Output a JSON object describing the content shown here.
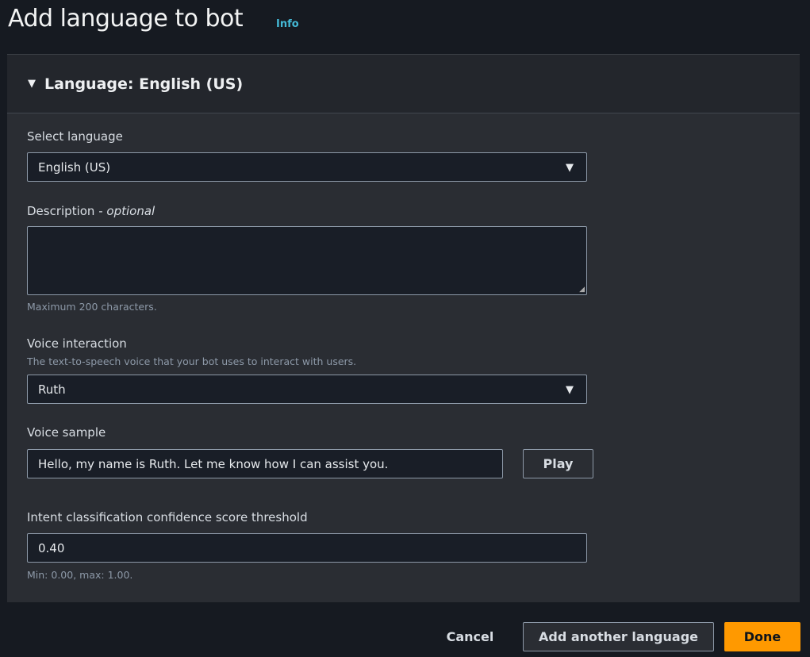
{
  "page": {
    "title": "Add language to bot",
    "info_link": "Info"
  },
  "panel": {
    "header": "Language: English (US)"
  },
  "fields": {
    "language": {
      "label": "Select language",
      "value": "English (US)"
    },
    "description": {
      "label": "Description - ",
      "label_optional": "optional",
      "value": "",
      "hint": "Maximum 200 characters."
    },
    "voice": {
      "label": "Voice interaction",
      "hint": "The text-to-speech voice that your bot uses to interact with users.",
      "value": "Ruth"
    },
    "sample": {
      "label": "Voice sample",
      "value": "Hello, my name is Ruth. Let me know how I can assist you.",
      "play": "Play"
    },
    "threshold": {
      "label": "Intent classification confidence score threshold",
      "value": "0.40",
      "hint": "Min: 0.00, max: 1.00."
    }
  },
  "footer": {
    "cancel": "Cancel",
    "add": "Add another language",
    "done": "Done"
  },
  "colors": {
    "accent": "#ff9900",
    "link": "#44b9d6"
  }
}
